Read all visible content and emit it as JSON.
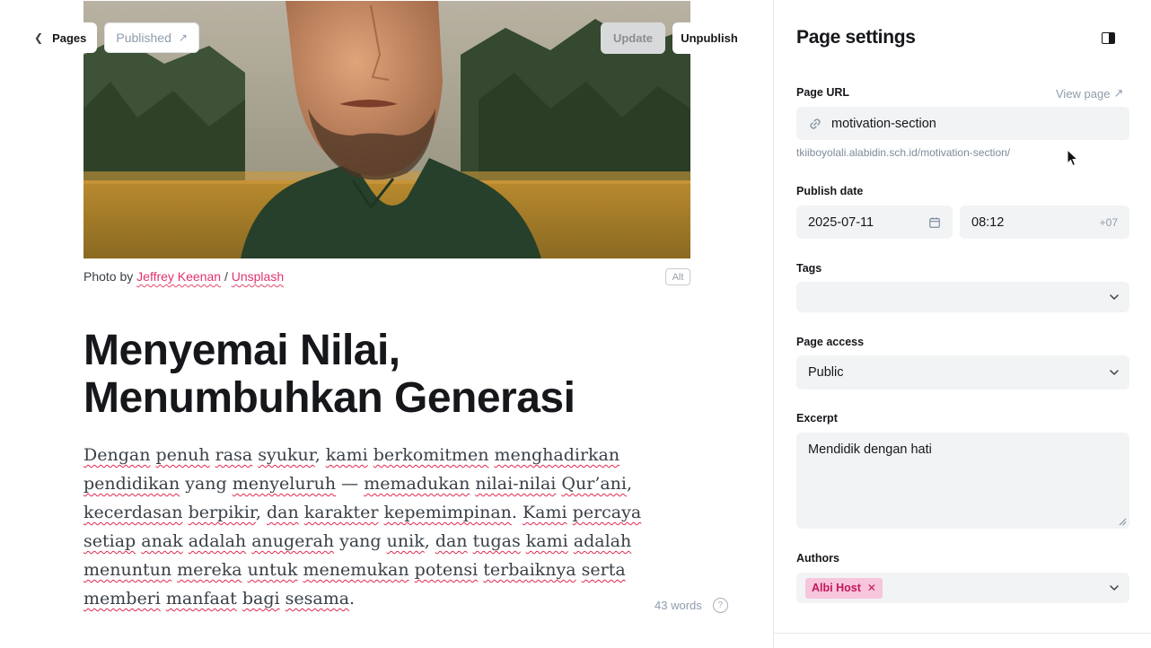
{
  "topbar": {
    "back_label": "Pages",
    "status_label": "Published",
    "update_label": "Update",
    "unpublish_label": "Unpublish"
  },
  "feature_image": {
    "caption_prefix": "Photo by ",
    "photographer": "Jeffrey Keenan",
    "separator": " / ",
    "source": "Unsplash",
    "alt_label": "Alt"
  },
  "post": {
    "title": "Menyemai Nilai, Menumbuhkan Generasi",
    "body": "Dengan penuh rasa syukur, kami berkomitmen menghadirkan pendidikan yang menyeluruh — memadukan nilai-nilai Qur’ani, kecerdasan berpikir, dan karakter kepemimpinan. Kami percaya setiap anak adalah anugerah yang unik, dan tugas kami adalah menuntun mereka untuk menemukan potensi terbaiknya serta memberi manfaat bagi sesama.",
    "word_count": "43 words"
  },
  "settings": {
    "title": "Page settings",
    "url": {
      "label": "Page URL",
      "view_page": "View page",
      "value": "motivation-section",
      "full_url": "tkiiboyolali.alabidin.sch.id/motivation-section/"
    },
    "publish_date": {
      "label": "Publish date",
      "date": "2025-07-11",
      "time": "08:12",
      "timezone": "+07"
    },
    "tags": {
      "label": "Tags",
      "value": ""
    },
    "access": {
      "label": "Page access",
      "value": "Public"
    },
    "excerpt": {
      "label": "Excerpt",
      "value": "Mendidik dengan hati"
    },
    "authors": {
      "label": "Authors",
      "items": [
        "Albi Host"
      ]
    }
  },
  "colors": {
    "accent_pink": "#e3326f",
    "chip_bg": "#f7c6dc",
    "field_bg": "#f1f3f4"
  }
}
